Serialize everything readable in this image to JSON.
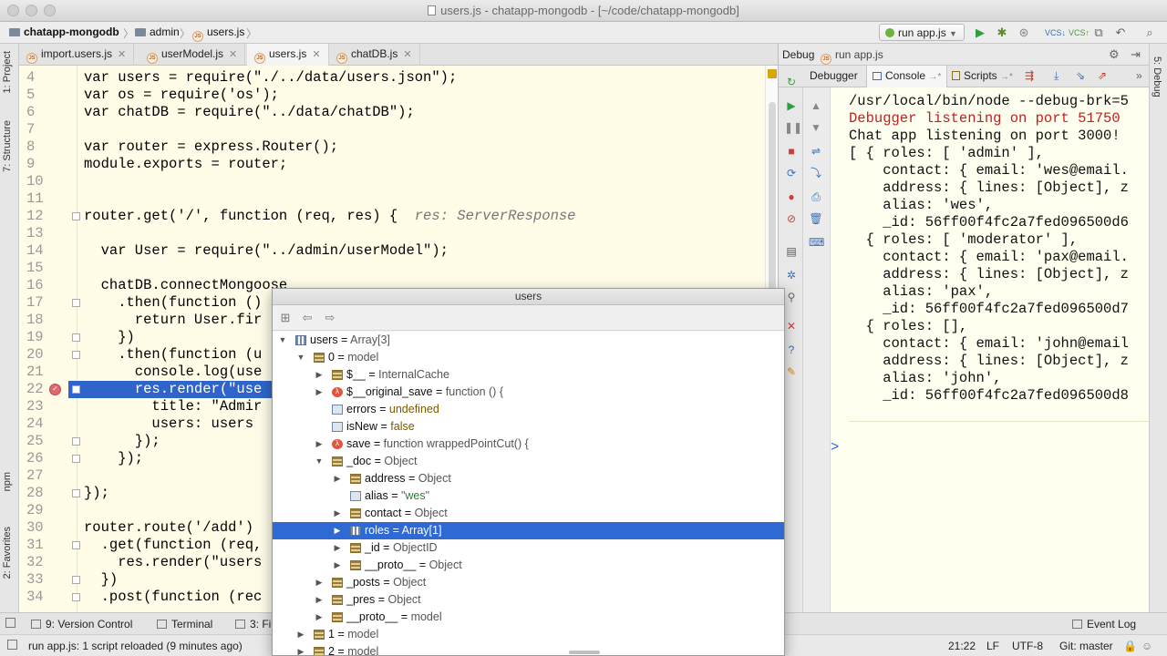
{
  "window": {
    "title": "users.js - chatapp-mongodb - [~/code/chatapp-mongodb]"
  },
  "breadcrumb": {
    "project": "chatapp-mongodb",
    "folder": "admin",
    "file": "users.js"
  },
  "toolbar": {
    "run_config": "run app.js"
  },
  "left_strip": {
    "project": "1: Project",
    "structure": "7: Structure",
    "npm": "npm",
    "favorites": "2: Favorites"
  },
  "right_strip": {
    "debug": "5: Debug"
  },
  "editor_tabs": [
    {
      "label": "import.users.js"
    },
    {
      "label": "userModel.js"
    },
    {
      "label": "users.js"
    },
    {
      "label": "chatDB.js"
    }
  ],
  "code": {
    "lines": [
      {
        "n": "4",
        "text": "var users = require(\"./../data/users.json\");"
      },
      {
        "n": "5",
        "text": "var os = require('os');"
      },
      {
        "n": "6",
        "text": "var chatDB = require(\"../data/chatDB\");"
      },
      {
        "n": "7",
        "text": ""
      },
      {
        "n": "8",
        "text": "var router = express.Router();"
      },
      {
        "n": "9",
        "text": "module.exports = router;"
      },
      {
        "n": "10",
        "text": ""
      },
      {
        "n": "11",
        "text": ""
      },
      {
        "n": "12",
        "text": "router.get('/', function (req, res) {"
      },
      {
        "n": "13",
        "text": ""
      },
      {
        "n": "14",
        "text": "  var User = require(\"../admin/userModel\");"
      },
      {
        "n": "15",
        "text": ""
      },
      {
        "n": "16",
        "text": "  chatDB.connectMongoose"
      },
      {
        "n": "17",
        "text": "    .then(function ()"
      },
      {
        "n": "18",
        "text": "      return User.fir"
      },
      {
        "n": "19",
        "text": "    })"
      },
      {
        "n": "20",
        "text": "    .then(function (u"
      },
      {
        "n": "21",
        "text": "      console.log(use"
      },
      {
        "n": "22",
        "text": "      res.render(\"use"
      },
      {
        "n": "23",
        "text": "        title: \"Admir"
      },
      {
        "n": "24",
        "text": "        users: users"
      },
      {
        "n": "25",
        "text": "      });"
      },
      {
        "n": "26",
        "text": "    });"
      },
      {
        "n": "27",
        "text": ""
      },
      {
        "n": "28",
        "text": "});"
      },
      {
        "n": "29",
        "text": ""
      },
      {
        "n": "30",
        "text": "router.route('/add')"
      },
      {
        "n": "31",
        "text": "  .get(function (req,"
      },
      {
        "n": "32",
        "text": "    res.render(\"users"
      },
      {
        "n": "33",
        "text": "  })"
      },
      {
        "n": "34",
        "text": "  .post(function (rec"
      }
    ],
    "inline_hint": "res: ServerResponse"
  },
  "debug": {
    "title": "Debug",
    "config": "run app.js",
    "tabs": [
      "Debugger",
      "Console",
      "Scripts"
    ],
    "console_lines": [
      {
        "text": "/usr/local/bin/node --debug-brk=5",
        "style": "normal"
      },
      {
        "text": "Debugger listening on port 51750",
        "style": "red"
      },
      {
        "text": "Chat app listening on port 3000!",
        "style": "normal"
      },
      {
        "text": "[ { roles: [ 'admin' ],",
        "style": "normal"
      },
      {
        "text": "    contact: { email: 'wes@email.",
        "style": "normal"
      },
      {
        "text": "    address: { lines: [Object], z",
        "style": "normal"
      },
      {
        "text": "    alias: 'wes',",
        "style": "normal"
      },
      {
        "text": "    _id: 56ff00f4fc2a7fed096500d6",
        "style": "normal"
      },
      {
        "text": "  { roles: [ 'moderator' ],",
        "style": "normal"
      },
      {
        "text": "    contact: { email: 'pax@email.",
        "style": "normal"
      },
      {
        "text": "    address: { lines: [Object], z",
        "style": "normal"
      },
      {
        "text": "    alias: 'pax',",
        "style": "normal"
      },
      {
        "text": "    _id: 56ff00f4fc2a7fed096500d7",
        "style": "normal"
      },
      {
        "text": "  { roles: [],",
        "style": "normal"
      },
      {
        "text": "    contact: { email: 'john@email",
        "style": "normal"
      },
      {
        "text": "    address: { lines: [Object], z",
        "style": "normal"
      },
      {
        "text": "    alias: 'john',",
        "style": "normal"
      },
      {
        "text": "    _id: 56ff00f4fc2a7fed096500d8",
        "style": "normal"
      }
    ],
    "prompt": ">"
  },
  "popup": {
    "title": "users",
    "tree": [
      {
        "depth": 0,
        "toggle": "open",
        "icon": "arr",
        "name": "users",
        "sep": " = ",
        "value": "Array[3]",
        "vstyle": "plain"
      },
      {
        "depth": 1,
        "toggle": "open",
        "icon": "stack",
        "name": "0",
        "sep": " = ",
        "value": "model",
        "vstyle": "plain"
      },
      {
        "depth": 2,
        "toggle": "closed",
        "icon": "stack",
        "name": "$__",
        "sep": " = ",
        "value": "InternalCache",
        "vstyle": "plain"
      },
      {
        "depth": 2,
        "toggle": "closed",
        "icon": "func",
        "name": "$__original_save",
        "sep": " = ",
        "value": "function () {",
        "vstyle": "plain"
      },
      {
        "depth": 2,
        "toggle": "none",
        "icon": "prim",
        "name": "errors",
        "sep": " = ",
        "value": "undefined",
        "vstyle": "kw"
      },
      {
        "depth": 2,
        "toggle": "none",
        "icon": "prim",
        "name": "isNew",
        "sep": " = ",
        "value": "false",
        "vstyle": "kw"
      },
      {
        "depth": 2,
        "toggle": "closed",
        "icon": "func",
        "name": "save",
        "sep": " = ",
        "value": "function wrappedPointCut() {",
        "vstyle": "plain"
      },
      {
        "depth": 2,
        "toggle": "open",
        "icon": "stack",
        "name": "_doc",
        "sep": " = ",
        "value": "Object",
        "vstyle": "plain"
      },
      {
        "depth": 3,
        "toggle": "closed",
        "icon": "stack",
        "name": "address",
        "sep": " = ",
        "value": "Object",
        "vstyle": "plain"
      },
      {
        "depth": 3,
        "toggle": "none",
        "icon": "prim",
        "name": "alias",
        "sep": " = ",
        "value": "\"wes\"",
        "vstyle": "str"
      },
      {
        "depth": 3,
        "toggle": "closed",
        "icon": "stack",
        "name": "contact",
        "sep": " = ",
        "value": "Object",
        "vstyle": "plain"
      },
      {
        "depth": 3,
        "toggle": "closed",
        "icon": "arr",
        "name": "roles",
        "sep": " = ",
        "value": "Array[1]",
        "vstyle": "plain",
        "selected": true
      },
      {
        "depth": 3,
        "toggle": "closed",
        "icon": "stack",
        "name": "_id",
        "sep": " = ",
        "value": "ObjectID",
        "vstyle": "plain"
      },
      {
        "depth": 3,
        "toggle": "closed",
        "icon": "stack",
        "name": "__proto__",
        "sep": " = ",
        "value": "Object",
        "vstyle": "plain"
      },
      {
        "depth": 2,
        "toggle": "closed",
        "icon": "stack",
        "name": "_posts",
        "sep": " = ",
        "value": "Object",
        "vstyle": "plain"
      },
      {
        "depth": 2,
        "toggle": "closed",
        "icon": "stack",
        "name": "_pres",
        "sep": " = ",
        "value": "Object",
        "vstyle": "plain"
      },
      {
        "depth": 2,
        "toggle": "closed",
        "icon": "stack",
        "name": "__proto__",
        "sep": " = ",
        "value": "model",
        "vstyle": "plain"
      },
      {
        "depth": 1,
        "toggle": "closed",
        "icon": "stack",
        "name": "1",
        "sep": " = ",
        "value": "model",
        "vstyle": "plain"
      },
      {
        "depth": 1,
        "toggle": "closed",
        "icon": "stack",
        "name": "2",
        "sep": " = ",
        "value": "model",
        "vstyle": "plain"
      }
    ]
  },
  "tool_windows": {
    "version_control": "9: Version Control",
    "terminal": "Terminal",
    "find": "3: Fi",
    "event_log": "Event Log"
  },
  "status": {
    "message": "run app.js: 1 script reloaded (9 minutes ago)",
    "position": "21:22",
    "line_sep": "LF",
    "encoding": "UTF-8",
    "vcs": "Git: master"
  },
  "colors": {
    "selection": "#2f6ad4",
    "exec_line": "#2f65ca",
    "editor_bg": "#fffde8",
    "console_red": "#c21f1f"
  }
}
